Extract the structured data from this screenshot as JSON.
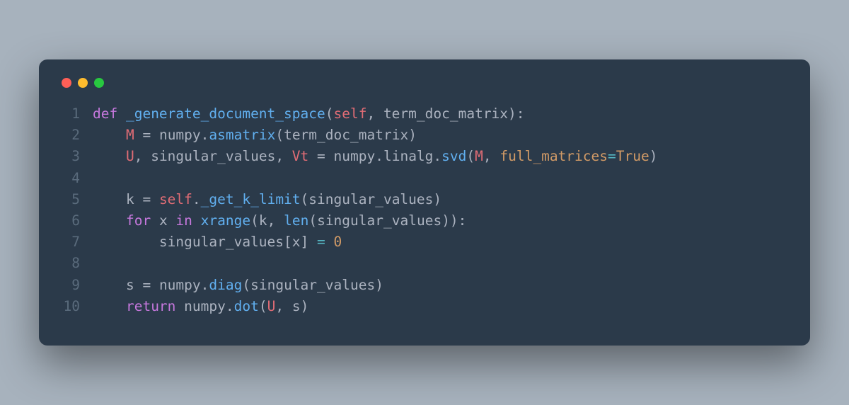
{
  "window": {
    "dot_red": "#ff5f57",
    "dot_yellow": "#febc2e",
    "dot_green": "#28c840"
  },
  "code": {
    "language": "python",
    "lines": [
      {
        "n": "1",
        "tokens": [
          {
            "cls": "tok-def",
            "t": "def "
          },
          {
            "cls": "tok-fn",
            "t": "_generate_document_space"
          },
          {
            "cls": "tok-punc",
            "t": "("
          },
          {
            "cls": "tok-self",
            "t": "self"
          },
          {
            "cls": "tok-punc",
            "t": ", "
          },
          {
            "cls": "tok-param",
            "t": "term_doc_matrix"
          },
          {
            "cls": "tok-punc",
            "t": "):"
          }
        ]
      },
      {
        "n": "2",
        "tokens": [
          {
            "cls": "tok-ident",
            "t": "    "
          },
          {
            "cls": "tok-var",
            "t": "M"
          },
          {
            "cls": "tok-op",
            "t": " = "
          },
          {
            "cls": "tok-ident",
            "t": "numpy"
          },
          {
            "cls": "tok-punc",
            "t": "."
          },
          {
            "cls": "tok-call",
            "t": "asmatrix"
          },
          {
            "cls": "tok-punc",
            "t": "("
          },
          {
            "cls": "tok-ident",
            "t": "term_doc_matrix"
          },
          {
            "cls": "tok-punc",
            "t": ")"
          }
        ]
      },
      {
        "n": "3",
        "tokens": [
          {
            "cls": "tok-ident",
            "t": "    "
          },
          {
            "cls": "tok-var",
            "t": "U"
          },
          {
            "cls": "tok-punc",
            "t": ", "
          },
          {
            "cls": "tok-ident",
            "t": "singular_values"
          },
          {
            "cls": "tok-punc",
            "t": ", "
          },
          {
            "cls": "tok-var",
            "t": "Vt"
          },
          {
            "cls": "tok-op",
            "t": " = "
          },
          {
            "cls": "tok-ident",
            "t": "numpy"
          },
          {
            "cls": "tok-punc",
            "t": "."
          },
          {
            "cls": "tok-ident",
            "t": "linalg"
          },
          {
            "cls": "tok-punc",
            "t": "."
          },
          {
            "cls": "tok-call",
            "t": "svd"
          },
          {
            "cls": "tok-punc",
            "t": "("
          },
          {
            "cls": "tok-var",
            "t": "M"
          },
          {
            "cls": "tok-punc",
            "t": ", "
          },
          {
            "cls": "tok-named",
            "t": "full_matrices"
          },
          {
            "cls": "tok-op2",
            "t": "="
          },
          {
            "cls": "tok-bool",
            "t": "True"
          },
          {
            "cls": "tok-punc",
            "t": ")"
          }
        ]
      },
      {
        "n": "4",
        "tokens": [
          {
            "cls": "tok-ident",
            "t": ""
          }
        ]
      },
      {
        "n": "5",
        "tokens": [
          {
            "cls": "tok-ident",
            "t": "    "
          },
          {
            "cls": "tok-ident",
            "t": "k "
          },
          {
            "cls": "tok-op",
            "t": "= "
          },
          {
            "cls": "tok-self",
            "t": "self"
          },
          {
            "cls": "tok-punc",
            "t": "."
          },
          {
            "cls": "tok-call",
            "t": "_get_k_limit"
          },
          {
            "cls": "tok-punc",
            "t": "("
          },
          {
            "cls": "tok-ident",
            "t": "singular_values"
          },
          {
            "cls": "tok-punc",
            "t": ")"
          }
        ]
      },
      {
        "n": "6",
        "tokens": [
          {
            "cls": "tok-ident",
            "t": "    "
          },
          {
            "cls": "tok-kw",
            "t": "for "
          },
          {
            "cls": "tok-ident",
            "t": "x "
          },
          {
            "cls": "tok-kw",
            "t": "in "
          },
          {
            "cls": "tok-call",
            "t": "xrange"
          },
          {
            "cls": "tok-punc",
            "t": "("
          },
          {
            "cls": "tok-ident",
            "t": "k"
          },
          {
            "cls": "tok-punc",
            "t": ", "
          },
          {
            "cls": "tok-call",
            "t": "len"
          },
          {
            "cls": "tok-punc",
            "t": "("
          },
          {
            "cls": "tok-ident",
            "t": "singular_values"
          },
          {
            "cls": "tok-punc",
            "t": ")):"
          }
        ]
      },
      {
        "n": "7",
        "tokens": [
          {
            "cls": "tok-ident",
            "t": "        "
          },
          {
            "cls": "tok-ident",
            "t": "singular_values"
          },
          {
            "cls": "tok-punc",
            "t": "["
          },
          {
            "cls": "tok-ident",
            "t": "x"
          },
          {
            "cls": "tok-punc",
            "t": "] "
          },
          {
            "cls": "tok-op2",
            "t": "= "
          },
          {
            "cls": "tok-num",
            "t": "0"
          }
        ]
      },
      {
        "n": "8",
        "tokens": [
          {
            "cls": "tok-ident",
            "t": ""
          }
        ]
      },
      {
        "n": "9",
        "tokens": [
          {
            "cls": "tok-ident",
            "t": "    "
          },
          {
            "cls": "tok-ident",
            "t": "s "
          },
          {
            "cls": "tok-op",
            "t": "= "
          },
          {
            "cls": "tok-ident",
            "t": "numpy"
          },
          {
            "cls": "tok-punc",
            "t": "."
          },
          {
            "cls": "tok-call",
            "t": "diag"
          },
          {
            "cls": "tok-punc",
            "t": "("
          },
          {
            "cls": "tok-ident",
            "t": "singular_values"
          },
          {
            "cls": "tok-punc",
            "t": ")"
          }
        ]
      },
      {
        "n": "10",
        "tokens": [
          {
            "cls": "tok-ident",
            "t": "    "
          },
          {
            "cls": "tok-kw",
            "t": "return "
          },
          {
            "cls": "tok-ident",
            "t": "numpy"
          },
          {
            "cls": "tok-punc",
            "t": "."
          },
          {
            "cls": "tok-call",
            "t": "dot"
          },
          {
            "cls": "tok-punc",
            "t": "("
          },
          {
            "cls": "tok-var",
            "t": "U"
          },
          {
            "cls": "tok-punc",
            "t": ", "
          },
          {
            "cls": "tok-ident",
            "t": "s"
          },
          {
            "cls": "tok-punc",
            "t": ")"
          }
        ]
      }
    ]
  }
}
